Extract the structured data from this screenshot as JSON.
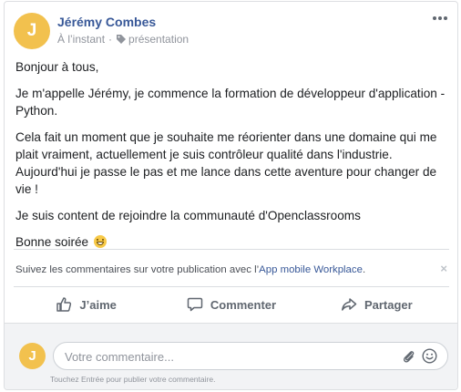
{
  "post": {
    "author": "Jérémy Combes",
    "avatar_letter": "J",
    "timestamp": "À l’instant",
    "separator": "·",
    "tag": "présentation",
    "paragraphs": [
      "Bonjour à tous,",
      "Je m'appelle Jérémy, je commence la formation de développeur d'application - Python.",
      "Cela fait un moment que je souhaite me réorienter dans une domaine qui me plait vraiment, actuellement je suis contrôleur qualité dans l'industrie. Aujourd'hui je passe le pas et me lance dans cette aventure pour changer de vie !",
      "Je suis content de rejoindre la communauté d'Openclassrooms"
    ],
    "closing": "Bonne soirée"
  },
  "notice": {
    "text_before": "Suivez les commentaires sur votre publication avec l’",
    "link": "App mobile Workplace",
    "text_after": ".",
    "close": "×"
  },
  "actions": {
    "like": "J’aime",
    "comment": "Commenter",
    "share": "Partager"
  },
  "comment_box": {
    "avatar_letter": "J",
    "placeholder": "Votre commentaire...",
    "hint": "Touchez Entrée pour publier votre commentaire."
  },
  "colors": {
    "avatar": "#f2c14e",
    "link": "#385898",
    "muted": "#90949c"
  },
  "icons": {
    "more": "more-icon",
    "tag": "tag-icon",
    "like": "thumbs-up-icon",
    "comment": "comment-bubble-icon",
    "share": "share-arrow-icon",
    "attach": "paperclip-icon",
    "emoji": "smiley-icon"
  }
}
